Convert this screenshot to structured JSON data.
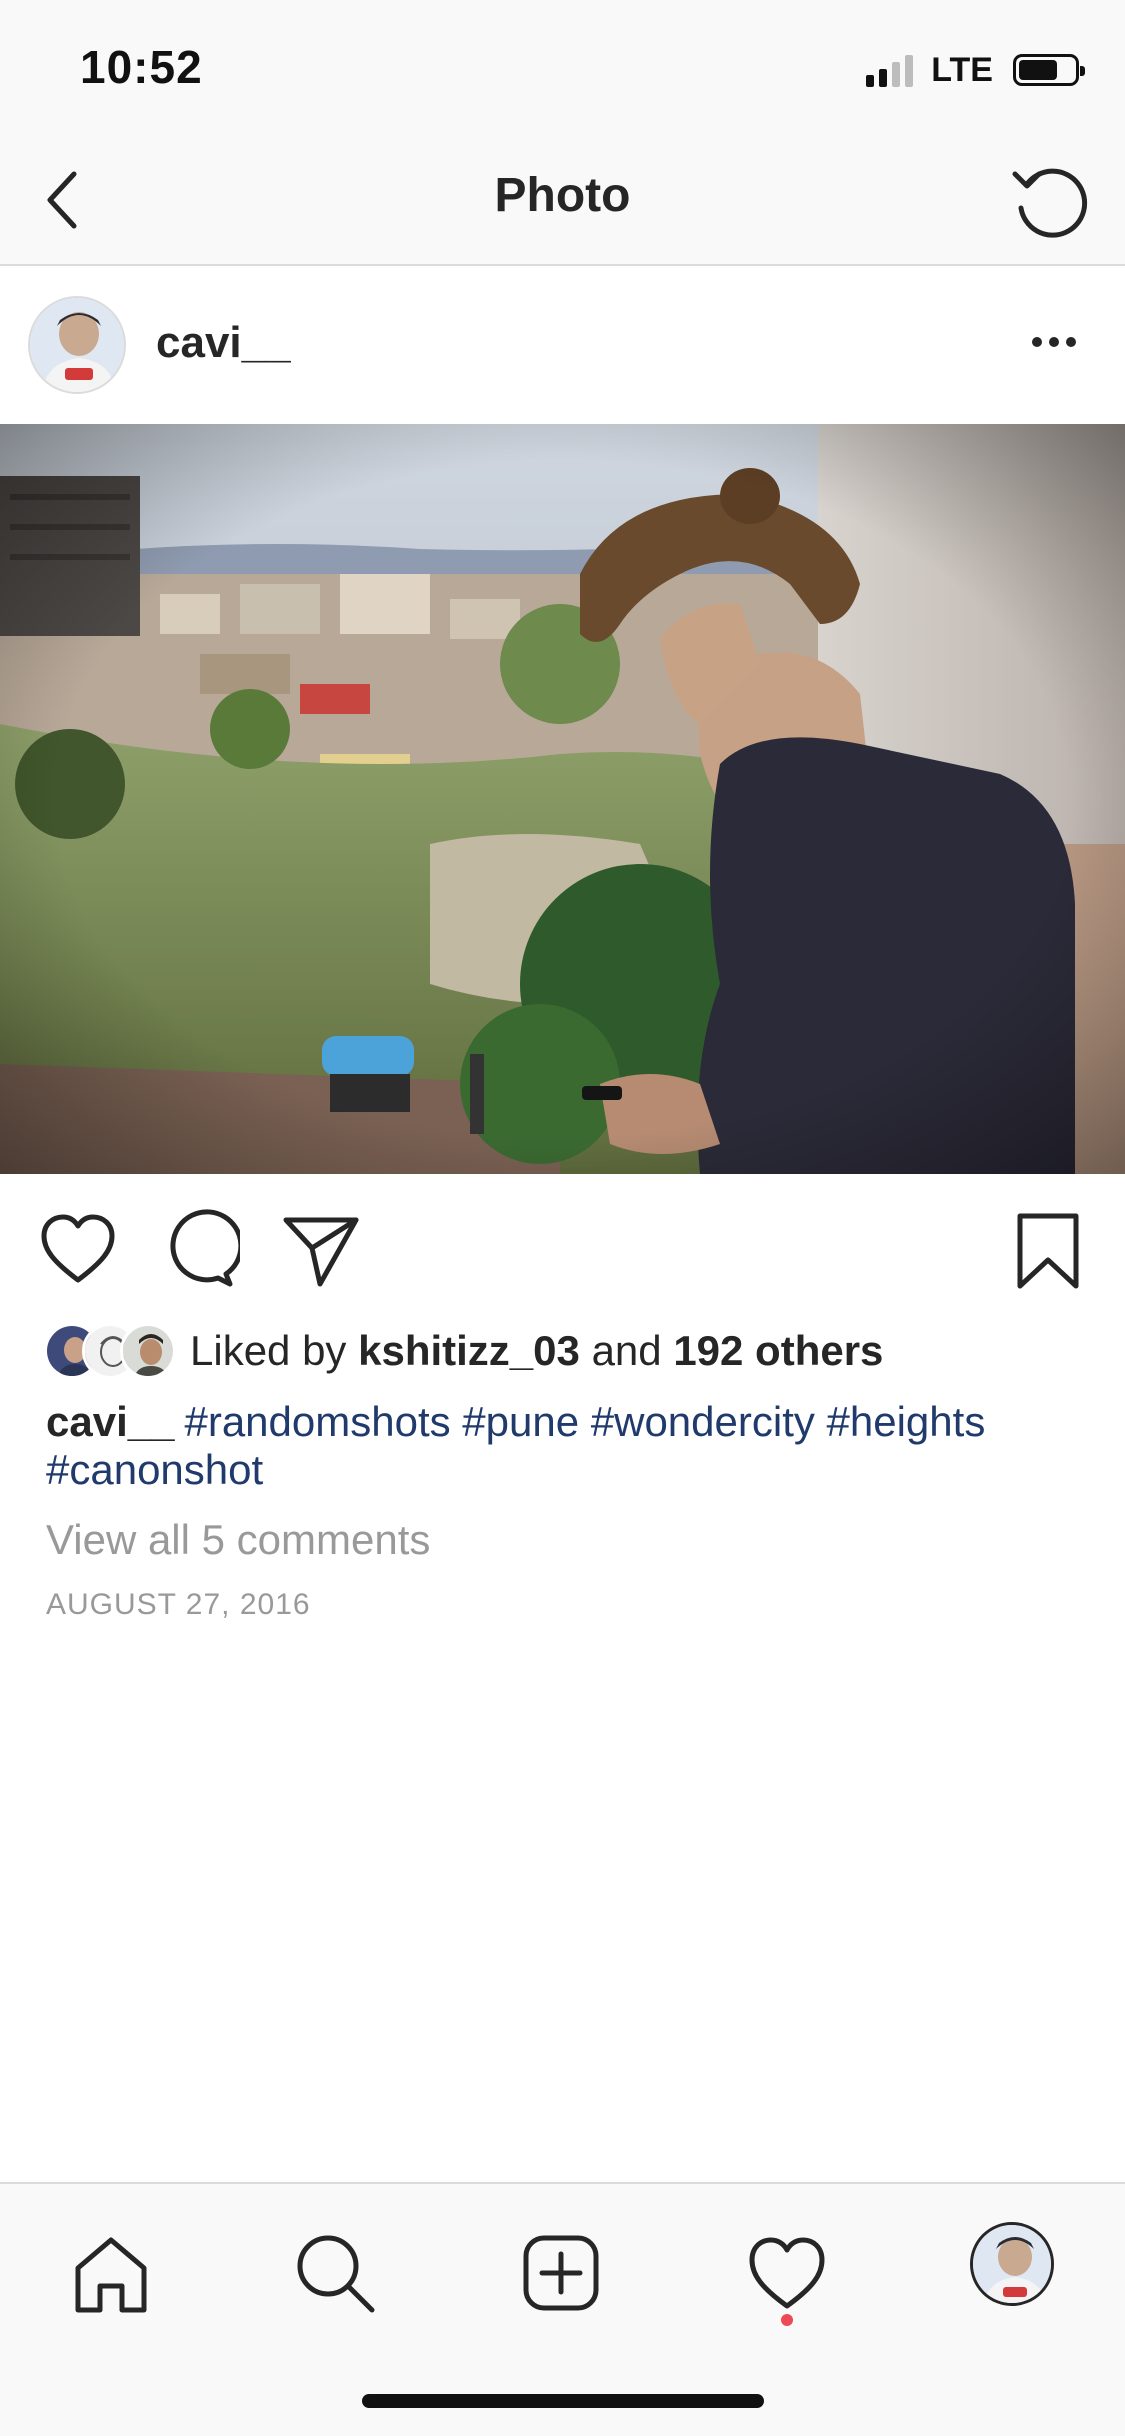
{
  "status_bar": {
    "time": "10:52",
    "network": "LTE",
    "signal_bars_filled": 2,
    "signal_bars_total": 4,
    "battery_level": 0.6
  },
  "header": {
    "title": "Photo",
    "back_icon": "chevron-left-icon",
    "refresh_icon": "refresh-icon"
  },
  "post": {
    "username": "cavi__",
    "likes": {
      "prefix": "Liked by",
      "user": "kshitizz_03",
      "joiner": "and",
      "others": "192 others"
    },
    "caption": {
      "user": "cavi__",
      "hashtags": "#randomshots #pune #wondercity #heights #canonshot"
    },
    "comments_link": "View all 5 comments",
    "date": "AUGUST 27, 2016"
  },
  "tabbar": {
    "items": [
      "home-icon",
      "search-icon",
      "add-post-icon",
      "activity-heart-icon",
      "profile-avatar"
    ],
    "active_notification_color": "#ed4956"
  },
  "colors": {
    "hashtag": "#1f3a6b",
    "muted": "#999999",
    "text": "#262626"
  }
}
